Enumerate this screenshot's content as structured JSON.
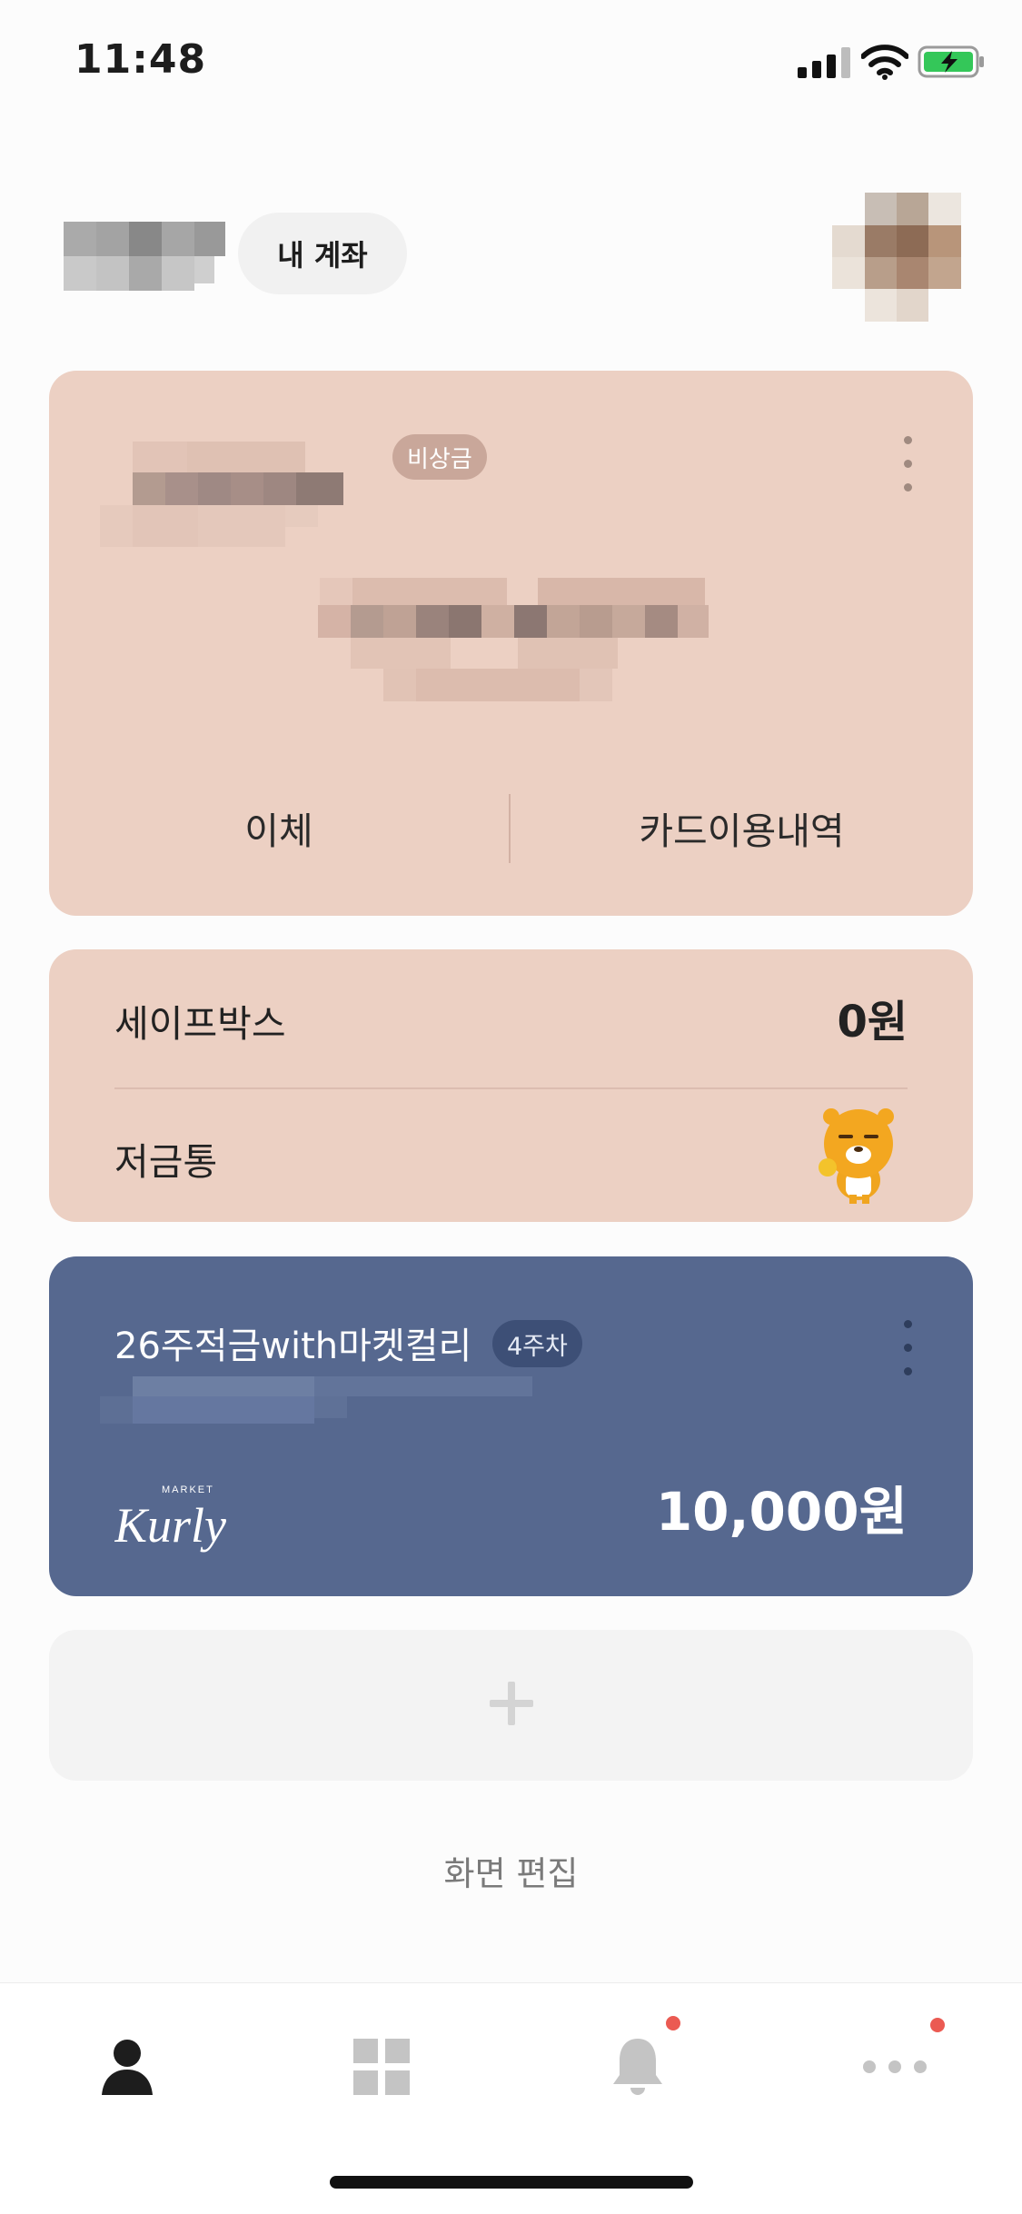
{
  "status_bar": {
    "time": "11:48",
    "signal_icon": "cellular-signal-icon",
    "wifi_icon": "wifi-icon",
    "battery_icon": "battery-charging-icon"
  },
  "header": {
    "my_account_label": "내 계좌"
  },
  "main_account_card": {
    "badge": "비상금",
    "actions": {
      "transfer": "이체",
      "card_history": "카드이용내역"
    },
    "background_color": "#ecd0c3"
  },
  "savings_card": {
    "safebox_label": "세이프박스",
    "safebox_amount": "0원",
    "piggybank_label": "저금통"
  },
  "installment_card": {
    "title": "26주적금with마켓컬리",
    "week_badge": "4주차",
    "amount": "10,000원",
    "logo_small": "MARKET",
    "logo_main": "Kurly",
    "background_color": "#56688f"
  },
  "add_card": {
    "icon": "plus-icon"
  },
  "edit_screen_label": "화면 편집",
  "tab_bar": {
    "tabs": [
      {
        "name": "tab-home",
        "icon": "person-icon",
        "active": true,
        "badge": false
      },
      {
        "name": "tab-products",
        "icon": "grid-icon",
        "active": false,
        "badge": false
      },
      {
        "name": "tab-notifications",
        "icon": "bell-icon",
        "active": false,
        "badge": true
      },
      {
        "name": "tab-more",
        "icon": "more-dots-icon",
        "active": false,
        "badge": true
      }
    ],
    "badge_color": "#eb5a52"
  }
}
